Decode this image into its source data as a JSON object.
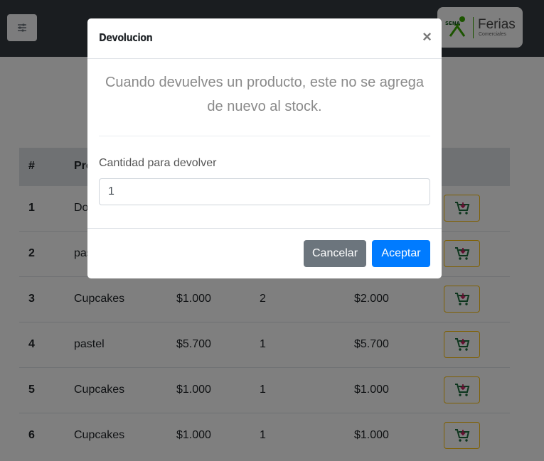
{
  "navbar": {
    "menu_icon": "sliders-icon",
    "brand": {
      "logo_text": "SENA",
      "title": "Ferias",
      "subtitle": "Comerciales"
    }
  },
  "table": {
    "headers": [
      "#",
      "Producto",
      "",
      "",
      "",
      ""
    ],
    "rows": [
      {
        "num": "1",
        "product": "Donas",
        "price": "",
        "qty": "",
        "total": ""
      },
      {
        "num": "2",
        "product": "pastel",
        "price": "",
        "qty": "",
        "total": ""
      },
      {
        "num": "3",
        "product": "Cupcakes",
        "price": "$1.000",
        "qty": "2",
        "total": "$2.000"
      },
      {
        "num": "4",
        "product": "pastel",
        "price": "$5.700",
        "qty": "1",
        "total": "$5.700"
      },
      {
        "num": "5",
        "product": "Cupcakes",
        "price": "$1.000",
        "qty": "1",
        "total": "$1.000"
      },
      {
        "num": "6",
        "product": "Cupcakes",
        "price": "$1.000",
        "qty": "1",
        "total": "$1.000"
      }
    ],
    "action_icon": "cart-return-icon"
  },
  "modal": {
    "title": "Devolucion",
    "close_label": "×",
    "message": "Cuando devuelves un producto, este no se agrega de nuevo al stock.",
    "quantity_label": "Cantidad para devolver",
    "quantity_value": "1",
    "cancel_label": "Cancelar",
    "accept_label": "Aceptar"
  },
  "colors": {
    "navbar": "#343a40",
    "accent_primary": "#007bff",
    "accent_secondary": "#6c757d",
    "action_border": "#ffc107",
    "sena_green": "#39a900"
  }
}
